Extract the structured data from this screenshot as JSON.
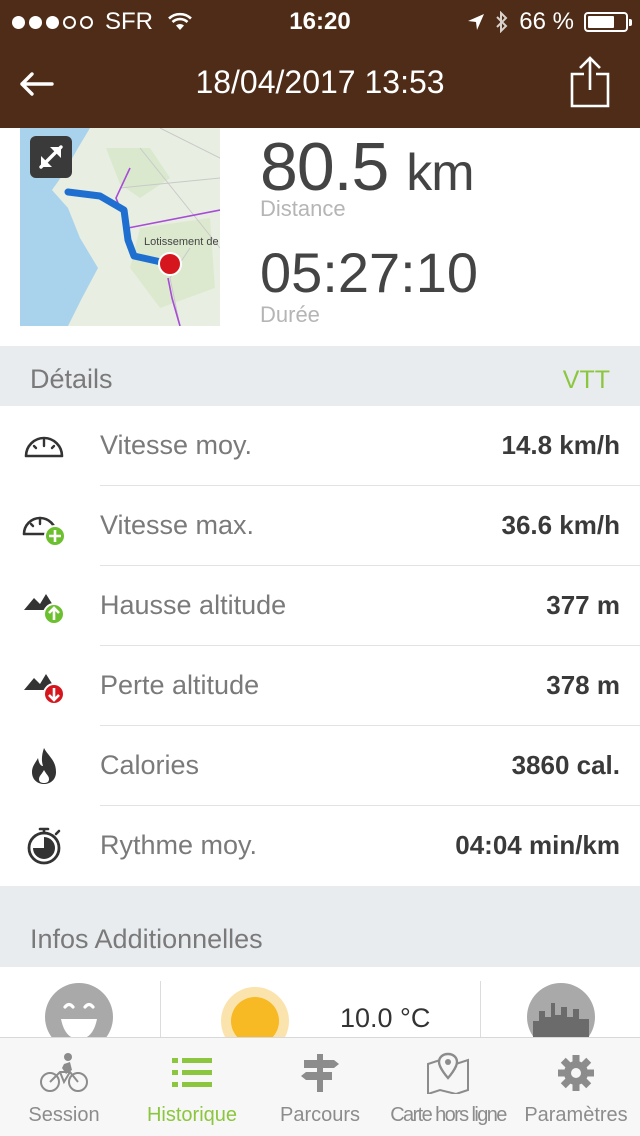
{
  "status_bar": {
    "carrier": "SFR",
    "time": "16:20",
    "battery": "66 %",
    "battery_level": 0.66,
    "signal_bars_filled": 3,
    "signal_bars_total": 5
  },
  "nav": {
    "title": "18/04/2017 13:53"
  },
  "map": {
    "place_label": "Lotissement de"
  },
  "summary": {
    "distance_value": "80.5",
    "distance_unit": "km",
    "distance_label": "Distance",
    "duration_value": "05:27:10",
    "duration_label": "Durée"
  },
  "details": {
    "title": "Détails",
    "activity": "VTT",
    "rows": [
      {
        "label": "Vitesse moy.",
        "value": "14.8 km/h",
        "icon": "speedometer-icon"
      },
      {
        "label": "Vitesse max.",
        "value": "36.6 km/h",
        "icon": "speedometer-max-icon"
      },
      {
        "label": "Hausse altitude",
        "value": "377 m",
        "icon": "altitude-gain-icon"
      },
      {
        "label": "Perte altitude",
        "value": "378 m",
        "icon": "altitude-loss-icon"
      },
      {
        "label": "Calories",
        "value": "3860 cal.",
        "icon": "flame-icon"
      },
      {
        "label": "Rythme moy.",
        "value": "04:04 min/km",
        "icon": "stopwatch-icon"
      }
    ]
  },
  "additional": {
    "title": "Infos Additionnelles",
    "temperature": "10.0 °C"
  },
  "tabs": [
    {
      "label": "Session",
      "icon": "cyclist-icon",
      "active": false
    },
    {
      "label": "Historique",
      "icon": "list-icon",
      "active": true
    },
    {
      "label": "Parcours",
      "icon": "signpost-icon",
      "active": false
    },
    {
      "label": "Carte hors ligne",
      "icon": "offline-map-icon",
      "active": false
    },
    {
      "label": "Paramètres",
      "icon": "gear-icon",
      "active": false
    }
  ],
  "colors": {
    "header": "#4e2c18",
    "accent": "#8cc63e",
    "track": "#1f6fd1",
    "endpoint": "#d6161e"
  }
}
